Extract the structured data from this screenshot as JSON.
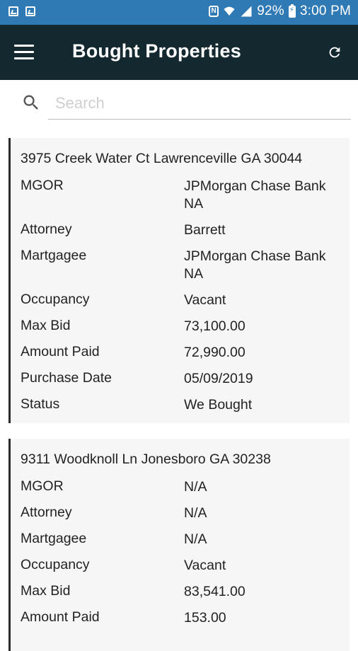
{
  "status_bar": {
    "battery": "92%",
    "time": "3:00 PM",
    "icons": [
      "image-icon",
      "mailbox-icon",
      "nfc-icon",
      "wifi-icon",
      "signal-icon",
      "battery-charging-icon"
    ]
  },
  "app_bar": {
    "title": "Bought Properties",
    "menu_icon": "hamburger-menu-icon",
    "refresh_icon": "refresh-icon"
  },
  "search": {
    "placeholder": "Search",
    "value": ""
  },
  "properties": [
    {
      "address": "3975 Creek Water Ct Lawrenceville GA 30044",
      "fields": [
        {
          "label": "MGOR",
          "value": "JPMorgan Chase Bank NA"
        },
        {
          "label": "Attorney",
          "value": "Barrett"
        },
        {
          "label": "Martgagee",
          "value": "JPMorgan Chase Bank NA"
        },
        {
          "label": "Occupancy",
          "value": "Vacant"
        },
        {
          "label": "Max Bid",
          "value": "73,100.00"
        },
        {
          "label": "Amount Paid",
          "value": "72,990.00"
        },
        {
          "label": "Purchase Date",
          "value": "05/09/2019"
        },
        {
          "label": "Status",
          "value": "We Bought"
        }
      ]
    },
    {
      "address": "9311 Woodknoll Ln Jonesboro GA 30238",
      "fields": [
        {
          "label": "MGOR",
          "value": "N/A"
        },
        {
          "label": "Attorney",
          "value": "N/A"
        },
        {
          "label": "Martgagee",
          "value": "N/A"
        },
        {
          "label": "Occupancy",
          "value": "Vacant"
        },
        {
          "label": "Max Bid",
          "value": "83,541.00"
        },
        {
          "label": "Amount Paid",
          "value": "153.00"
        }
      ]
    }
  ],
  "colors": {
    "status_bar": "#2f79b5",
    "app_bar": "#13292f",
    "card_bg": "#f6f6f6",
    "card_border": "#2b2b2b"
  }
}
